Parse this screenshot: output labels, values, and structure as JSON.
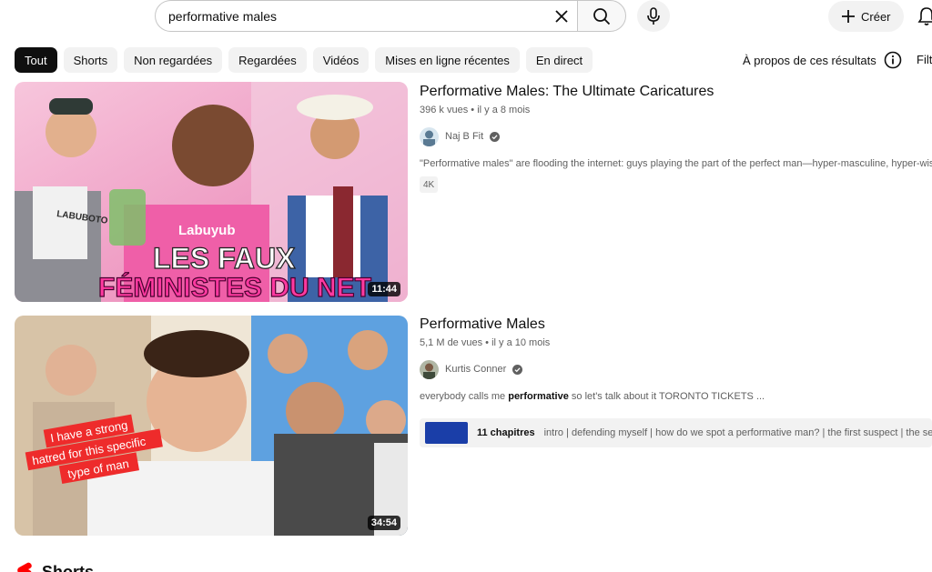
{
  "search": {
    "query": "performative males"
  },
  "header": {
    "create_label": "Créer"
  },
  "chips": [
    "Tout",
    "Shorts",
    "Non regardées",
    "Regardées",
    "Vidéos",
    "Mises en ligne récentes",
    "En direct"
  ],
  "about_label": "À propos de ces résultats",
  "filter_label": "Filt",
  "results": [
    {
      "title": "Performative Males: The Ultimate Caricatures",
      "views": "396 k vues",
      "age": "il y a 8 mois",
      "channel": "Naj B Fit",
      "description": "\"Performative males\" are flooding the internet: guys playing the part of the perfect man—hyper-masculine, hyper-wise, hype",
      "badge": "4K",
      "duration": "11:44",
      "thumb_text_1": "LES FAUX",
      "thumb_text_2": "FÉMINISTES DU NET",
      "thumb_brand": "Labuyub",
      "shirt_text": "LABUBOTO"
    },
    {
      "title": "Performative Males",
      "views": "5,1 M de vues",
      "age": "il y a 10 mois",
      "channel": "Kurtis Conner",
      "description_pre": "everybody calls me ",
      "description_bold": "performative",
      "description_post": " so let's talk about it TORONTO TICKETS ...",
      "chapters_count": "11 chapitres",
      "chapters_list": "intro | defending myself | how do we spot a performative man? | the first suspect | the second...",
      "duration": "34:54",
      "thumb_caption": [
        "I have a strong",
        "hatred for this specific",
        "type of man"
      ]
    }
  ],
  "shorts_label": "Shorts",
  "colors": {
    "accent": "#ff0000",
    "chip_active": "#0f0f0f",
    "chip_bg": "#f2f2f2",
    "meta": "#606060"
  }
}
